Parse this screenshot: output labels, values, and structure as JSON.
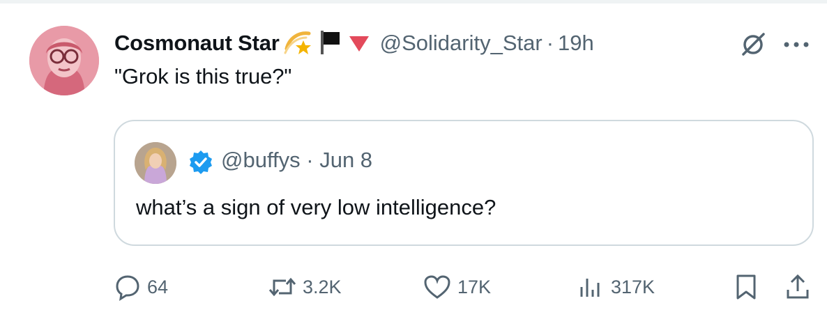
{
  "tweet": {
    "author_name": "Cosmonaut Star",
    "author_handle": "@Solidarity_Star",
    "separator": "·",
    "time": "19h",
    "text": "\"Grok is this true?\"",
    "name_icons": [
      "shooting-star-icon",
      "black-flag-icon",
      "red-triangle-icon"
    ]
  },
  "quote": {
    "handle": "@buffys",
    "separator": "·",
    "date": "Jun 8",
    "text": "what’s a sign of very low intelligence?",
    "verified": true
  },
  "actions": {
    "replies": "64",
    "reposts": "3.2K",
    "likes": "17K",
    "views": "317K"
  },
  "colors": {
    "text": "#0f1419",
    "secondary": "#536471",
    "verified": "#1d9bf0",
    "border": "#cfd9de",
    "flag_red": "#e0245e"
  }
}
